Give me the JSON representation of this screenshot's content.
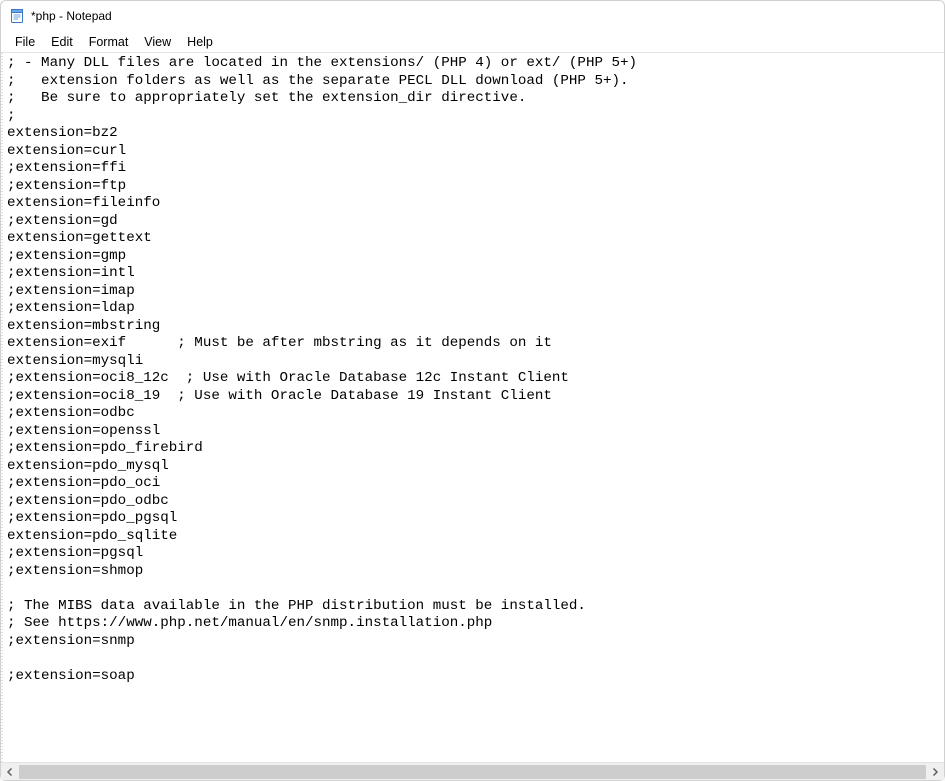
{
  "window": {
    "title": "*php - Notepad"
  },
  "menu": {
    "file": "File",
    "edit": "Edit",
    "format": "Format",
    "view": "View",
    "help": "Help"
  },
  "editor": {
    "content": "; - Many DLL files are located in the extensions/ (PHP 4) or ext/ (PHP 5+)\n;   extension folders as well as the separate PECL DLL download (PHP 5+).\n;   Be sure to appropriately set the extension_dir directive.\n;\nextension=bz2\nextension=curl\n;extension=ffi\n;extension=ftp\nextension=fileinfo\n;extension=gd\nextension=gettext\n;extension=gmp\n;extension=intl\n;extension=imap\n;extension=ldap\nextension=mbstring\nextension=exif      ; Must be after mbstring as it depends on it\nextension=mysqli\n;extension=oci8_12c  ; Use with Oracle Database 12c Instant Client\n;extension=oci8_19  ; Use with Oracle Database 19 Instant Client\n;extension=odbc\n;extension=openssl\n;extension=pdo_firebird\nextension=pdo_mysql\n;extension=pdo_oci\n;extension=pdo_odbc\n;extension=pdo_pgsql\nextension=pdo_sqlite\n;extension=pgsql\n;extension=shmop\n\n; The MIBS data available in the PHP distribution must be installed.\n; See https://www.php.net/manual/en/snmp.installation.php\n;extension=snmp\n\n;extension=soap\n"
  }
}
